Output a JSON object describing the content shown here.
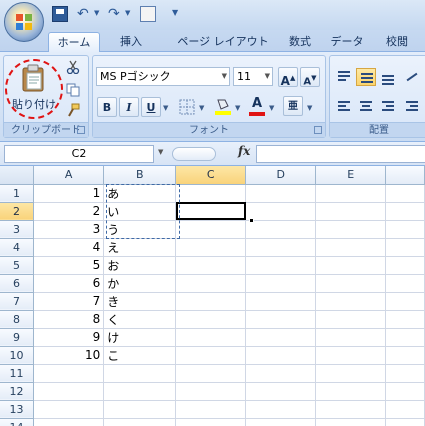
{
  "quick_access": {
    "save_icon": "save-icon",
    "undo_icon": "undo-icon",
    "redo_icon": "redo-icon",
    "preview_icon": "print-preview-icon"
  },
  "tabs": [
    {
      "label": "ホーム",
      "active": true
    },
    {
      "label": "挿入",
      "active": false
    },
    {
      "label": "ページ レイアウト",
      "active": false
    },
    {
      "label": "数式",
      "active": false
    },
    {
      "label": "データ",
      "active": false
    },
    {
      "label": "校閲",
      "active": false
    }
  ],
  "clipboard": {
    "paste_label": "貼り付け",
    "group_label": "クリップボード"
  },
  "font": {
    "name": "MS Pゴシック",
    "size": "11",
    "grow_label": "A",
    "shrink_label": "A",
    "bold": "B",
    "italic": "I",
    "underline": "U",
    "font_color_label": "A",
    "phonetic_label": "亜",
    "group_label": "フォント",
    "fill_color": "#ffff00",
    "text_color": "#e01414"
  },
  "alignment": {
    "group_label": "配置"
  },
  "formula_bar": {
    "name_box": "C2",
    "fx": "fx",
    "formula": ""
  },
  "sheet": {
    "columns": [
      "A",
      "B",
      "C",
      "D",
      "E"
    ],
    "selected_column": "C",
    "selected_row": "2",
    "rows": [
      {
        "n": "1",
        "a": "1",
        "b": "あ"
      },
      {
        "n": "2",
        "a": "2",
        "b": "い"
      },
      {
        "n": "3",
        "a": "3",
        "b": "う"
      },
      {
        "n": "4",
        "a": "4",
        "b": "え"
      },
      {
        "n": "5",
        "a": "5",
        "b": "お"
      },
      {
        "n": "6",
        "a": "6",
        "b": "か"
      },
      {
        "n": "7",
        "a": "7",
        "b": "き"
      },
      {
        "n": "8",
        "a": "8",
        "b": "く"
      },
      {
        "n": "9",
        "a": "9",
        "b": "け"
      },
      {
        "n": "10",
        "a": "10",
        "b": "こ"
      },
      {
        "n": "11",
        "a": "",
        "b": ""
      },
      {
        "n": "12",
        "a": "",
        "b": ""
      },
      {
        "n": "13",
        "a": "",
        "b": ""
      },
      {
        "n": "14",
        "a": "",
        "b": ""
      }
    ]
  }
}
